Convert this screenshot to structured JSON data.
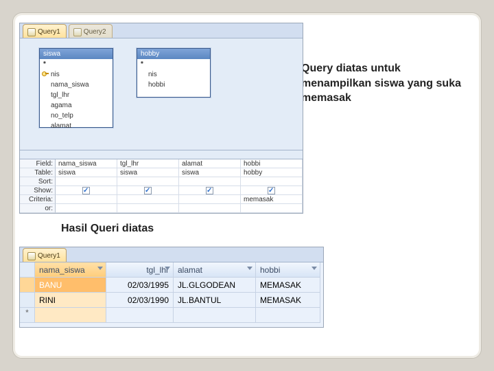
{
  "captions": {
    "right": "Query diatas untuk menampilkan siswa yang suka memasak",
    "left": "Hasil Queri diatas"
  },
  "query_design": {
    "tabs": [
      {
        "label": "Query1",
        "active": true
      },
      {
        "label": "Query2",
        "active": false
      }
    ],
    "tables": {
      "siswa": {
        "title": "siswa",
        "rows": [
          "*",
          "nis",
          "nama_siswa",
          "tgl_lhr",
          "agama",
          "no_telp",
          "alamat"
        ],
        "key_index": 1
      },
      "hobby": {
        "title": "hobby",
        "rows": [
          "*",
          "nis",
          "hobbi"
        ]
      }
    },
    "grid": {
      "row_labels": [
        "Field:",
        "Table:",
        "Sort:",
        "Show:",
        "Criteria:",
        "or:"
      ],
      "columns": [
        {
          "field": "nama_siswa",
          "table": "siswa",
          "sort": "",
          "show": true,
          "criteria": "",
          "or": ""
        },
        {
          "field": "tgl_lhr",
          "table": "siswa",
          "sort": "",
          "show": true,
          "criteria": "",
          "or": ""
        },
        {
          "field": "alamat",
          "table": "siswa",
          "sort": "",
          "show": true,
          "criteria": "",
          "or": ""
        },
        {
          "field": "hobbi",
          "table": "hobby",
          "sort": "",
          "show": true,
          "criteria": "memasak",
          "or": ""
        }
      ]
    }
  },
  "result": {
    "tab": "Query1",
    "headers": [
      "nama_siswa",
      "tgl_lhr",
      "alamat",
      "hobbi"
    ],
    "rows": [
      {
        "nama_siswa": "BANU",
        "tgl_lhr": "02/03/1995",
        "alamat": "JL.GLGODEAN",
        "hobbi": "MEMASAK",
        "selected": true
      },
      {
        "nama_siswa": "RINI",
        "tgl_lhr": "02/03/1990",
        "alamat": "JL.BANTUL",
        "hobbi": "MEMASAK",
        "selected": false
      }
    ],
    "new_row_marker": "*"
  }
}
